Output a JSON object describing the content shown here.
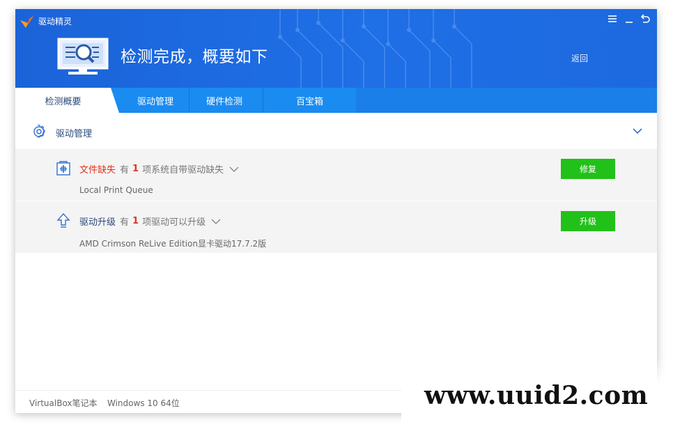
{
  "app": {
    "title": "驱动精灵"
  },
  "header": {
    "headline": "检测完成，概要如下",
    "back_label": "返回"
  },
  "tabs": [
    {
      "label": "检测概要",
      "active": true
    },
    {
      "label": "驱动管理",
      "active": false
    },
    {
      "label": "硬件检测",
      "active": false
    },
    {
      "label": "百宝箱",
      "active": false
    }
  ],
  "section": {
    "title": "驱动管理"
  },
  "items": [
    {
      "title": "文件缺失",
      "title_color": "#e1341e",
      "prefix": "有",
      "count": "1",
      "suffix": "项系统自带驱动缺失",
      "detail": "Local Print Queue",
      "button": "修复",
      "icon": "driver-file-icon"
    },
    {
      "title": "驱动升级",
      "title_color": "#2a4a7a",
      "prefix": "有",
      "count": "1",
      "suffix": "项驱动可以升级",
      "detail": "AMD Crimson ReLive Edition显卡驱动17.7.2版",
      "button": "升级",
      "icon": "upgrade-arrow-icon"
    }
  ],
  "footer": {
    "machine": "VirtualBox笔记本",
    "os": "Windows 10 64位"
  },
  "watermark": {
    "text": "www.uuid2.com"
  },
  "colors": {
    "header_blue": "#1b63d8",
    "tab_blue": "#1a8bf0",
    "action_green": "#22c11a",
    "alert_red": "#e1341e"
  }
}
